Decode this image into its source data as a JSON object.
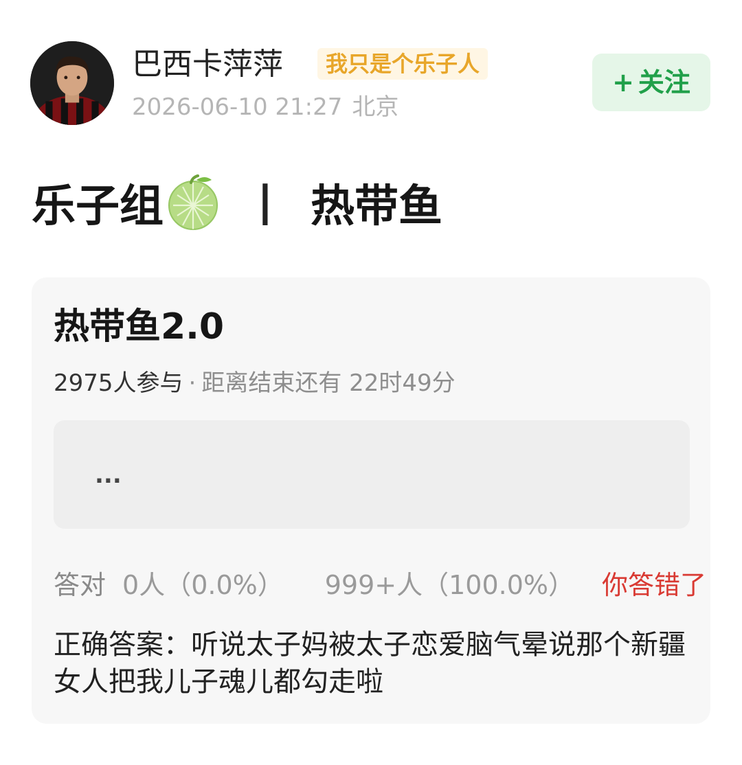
{
  "header": {
    "username": "巴西卡萍萍",
    "user_tag": "我只是个乐子人",
    "timestamp": "2026-06-10 21:27",
    "location": "北京",
    "follow_plus": "+",
    "follow_label": "关注"
  },
  "post": {
    "title_left": "乐子组",
    "title_separator": "丨",
    "title_right": "热带鱼"
  },
  "quiz": {
    "title": "热带鱼2.0",
    "participants": "2975人参与",
    "dot": "·",
    "countdown": "距离结束还有 22时49分",
    "answer_placeholder": "...",
    "correct_label": "答对",
    "correct_count": "0人（0.0%）",
    "wrong_count": "999+人（100.0%）",
    "verdict": "你答错了",
    "correct_answer": "正确答案：听说太子妈被太子恋爱脑气晕说那个新疆女人把我儿子魂儿都勾走啦"
  },
  "colors": {
    "follow_green": "#21a04a",
    "tag_orange": "#e8a62a",
    "wrong_red": "#d93a33"
  },
  "icons": {
    "melon": "melon-icon",
    "avatar": "avatar"
  }
}
